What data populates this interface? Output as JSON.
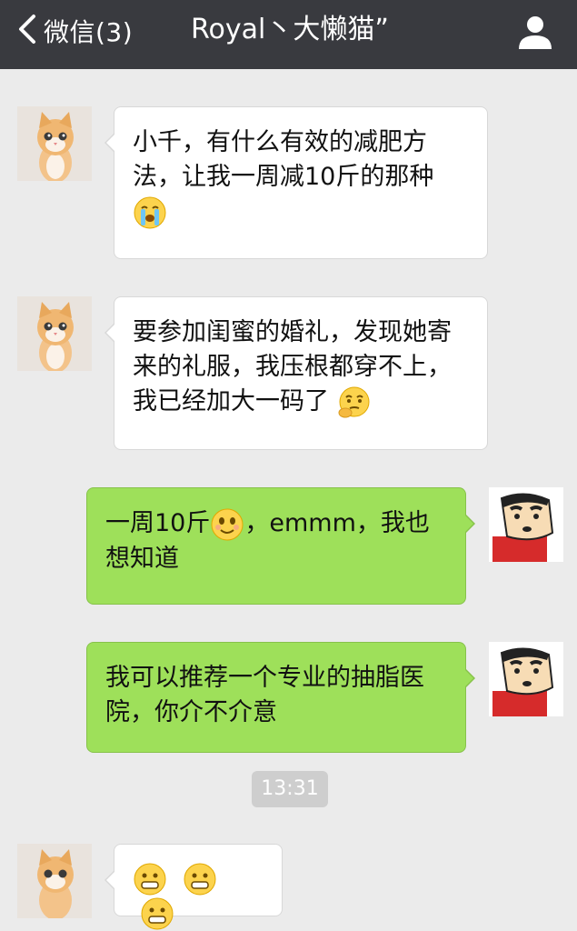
{
  "header": {
    "back_label": "微信(3)",
    "title": "Royal丶大懒猫”",
    "background": "#393a3f"
  },
  "messages": [
    {
      "side": "left",
      "avatar": "cat-avatar",
      "text": "小千，有什么有效的减肥方法，让我一周减10斤的那种",
      "emoji": "crying-face-emoji"
    },
    {
      "side": "left",
      "avatar": "cat-avatar",
      "text": "要参加闺蜜的婚礼，发现她寄来的礼服，我压根都穿不上，我已经加大一码了",
      "emoji": "thinking-face-emoji"
    },
    {
      "side": "right",
      "avatar": "cartoon-boy-avatar",
      "text_a": "一周10斤",
      "emoji": "smiling-face-emoji",
      "text_b": "，emmm，我也想知道"
    },
    {
      "side": "right",
      "avatar": "cartoon-boy-avatar",
      "text": "我可以推荐一个专业的抽脂医院，你介不介意"
    },
    {
      "side": "left",
      "avatar": "cat-avatar",
      "emojis": [
        "grimacing-face-emoji",
        "grimacing-face-emoji",
        "grimacing-face-emoji"
      ]
    }
  ],
  "timestamp": "13:31",
  "colors": {
    "chat_background": "#ebebeb",
    "incoming_bubble": "#ffffff",
    "outgoing_bubble": "#9ee05a",
    "timestamp_badge": "#cecece"
  }
}
